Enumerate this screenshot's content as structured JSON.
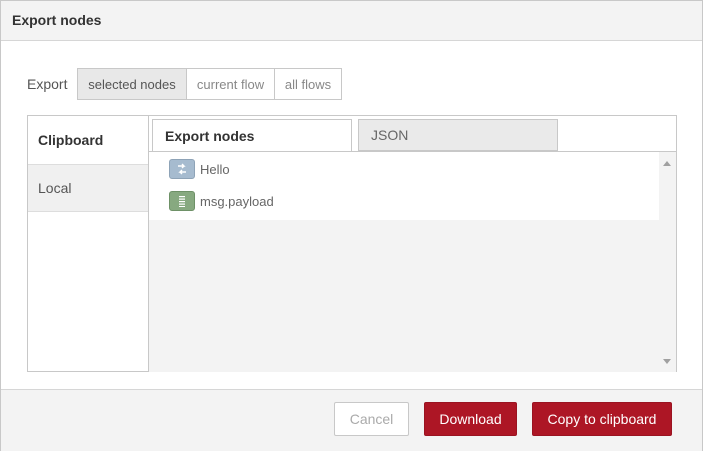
{
  "dialog": {
    "title": "Export nodes"
  },
  "export": {
    "label": "Export",
    "options": [
      {
        "label": "selected nodes",
        "selected": true
      },
      {
        "label": "current flow",
        "selected": false
      },
      {
        "label": "all flows",
        "selected": false
      }
    ]
  },
  "sidebar": {
    "items": [
      {
        "label": "Clipboard",
        "active": true
      },
      {
        "label": "Local",
        "active": false
      }
    ]
  },
  "tabs": [
    {
      "label": "Export nodes",
      "active": true
    },
    {
      "label": "JSON",
      "active": false
    }
  ],
  "nodes": [
    {
      "label": "Hello",
      "icon": "inject-arrow-icon",
      "color": "#a6bbcf"
    },
    {
      "label": "msg.payload",
      "icon": "debug-lines-icon",
      "color": "#87a980"
    }
  ],
  "footer": {
    "cancel_label": "Cancel",
    "download_label": "Download",
    "copy_label": "Copy to clipboard"
  },
  "colors": {
    "primary": "#ad1625",
    "accent_text": "#ffffff"
  }
}
